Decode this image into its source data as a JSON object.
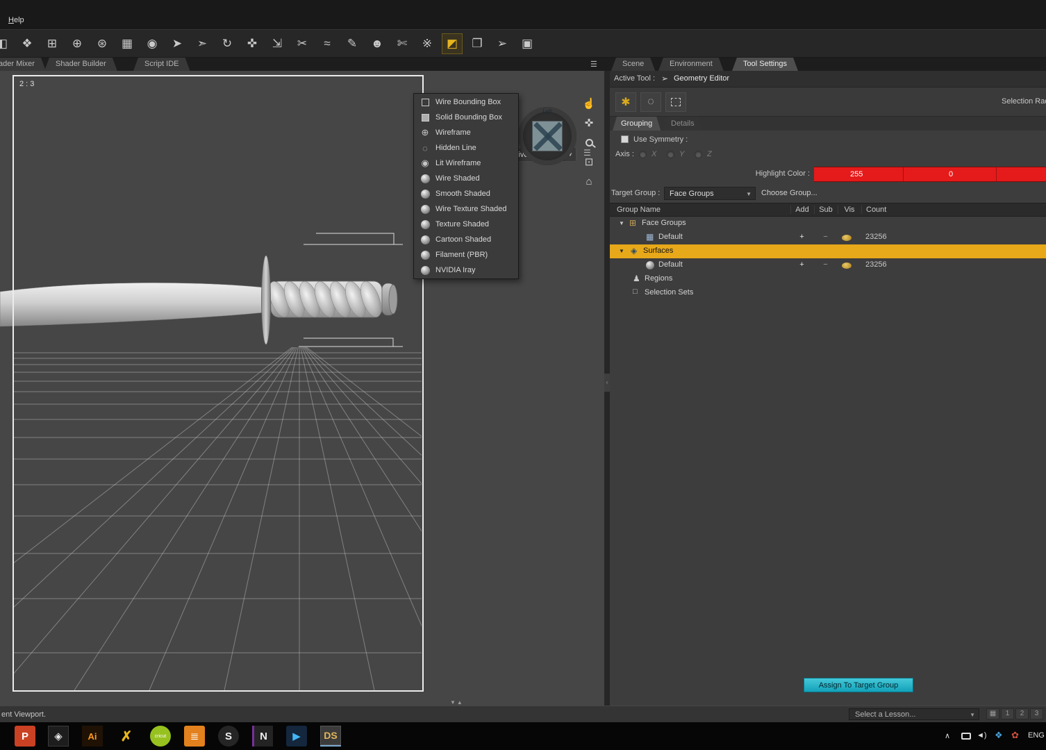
{
  "menubar": {
    "help": "Help"
  },
  "toolbar": {
    "icons": [
      {
        "name": "clipped-tool",
        "glyph": "◧"
      },
      {
        "name": "new-content",
        "glyph": "❖"
      },
      {
        "name": "add-figure",
        "glyph": "⊞"
      },
      {
        "name": "add-prop",
        "glyph": "⊕"
      },
      {
        "name": "add-light",
        "glyph": "⊛"
      },
      {
        "name": "grid-view",
        "glyph": "▦"
      },
      {
        "name": "scene-orb",
        "glyph": "◉"
      },
      {
        "name": "node-selection-tool",
        "glyph": "➤"
      },
      {
        "name": "geometry-selection-tool",
        "glyph": "➣"
      },
      {
        "name": "rotate-tool",
        "glyph": "↻"
      },
      {
        "name": "translate-tool",
        "glyph": "✜"
      },
      {
        "name": "scale-tool",
        "glyph": "⇲"
      },
      {
        "name": "scissors-tool",
        "glyph": "✂"
      },
      {
        "name": "curve-tool",
        "glyph": "≈"
      },
      {
        "name": "brush-tool",
        "glyph": "✎"
      },
      {
        "name": "figure-paint-tool",
        "glyph": "☻"
      },
      {
        "name": "polygon-cut-tool",
        "glyph": "✄"
      },
      {
        "name": "multi-cut-tool",
        "glyph": "※"
      },
      {
        "name": "geometry-editor-tool",
        "glyph": "◩"
      },
      {
        "name": "camera-cube-tool",
        "glyph": "❐"
      },
      {
        "name": "pointer-add-tool",
        "glyph": "➢"
      },
      {
        "name": "render-camera-tool",
        "glyph": "▣"
      }
    ]
  },
  "tabs": {
    "left": [
      "ader Mixer",
      "Shader Builder",
      "Script IDE"
    ],
    "right": [
      "Scene",
      "Environment",
      "Tool Settings"
    ]
  },
  "ui": {
    "arrow_down": "▼",
    "pane_icon": "☰",
    "tree_expanded": "▼"
  },
  "viewport": {
    "ratio_label": "2 : 3",
    "view_selector": "Perspective View",
    "orbit_label": "Left",
    "splitter_glyph": "▼▲",
    "nav_icons": [
      {
        "name": "orbit-icon",
        "glyph": "☝"
      },
      {
        "name": "pan-icon",
        "glyph": "✜"
      },
      {
        "name": "zoom-icon"
      },
      {
        "name": "frame-icon",
        "glyph": "⊡"
      },
      {
        "name": "home-icon",
        "glyph": "⌂"
      }
    ]
  },
  "draw_menu": {
    "items": [
      {
        "name": "wire-bounding-box",
        "label": "Wire Bounding Box"
      },
      {
        "name": "solid-bounding-box",
        "label": "Solid Bounding Box"
      },
      {
        "name": "wireframe",
        "label": "Wireframe",
        "glyph": "⊕"
      },
      {
        "name": "hidden-line",
        "label": "Hidden Line",
        "glyph": "◌"
      },
      {
        "name": "lit-wireframe",
        "label": "Lit Wireframe",
        "glyph": "◉"
      },
      {
        "name": "wire-shaded",
        "label": "Wire Shaded"
      },
      {
        "name": "smooth-shaded",
        "label": "Smooth Shaded"
      },
      {
        "name": "wire-texture-shaded",
        "label": "Wire Texture Shaded"
      },
      {
        "name": "texture-shaded",
        "label": "Texture Shaded"
      },
      {
        "name": "cartoon-shaded",
        "label": "Cartoon Shaded"
      },
      {
        "name": "filament-pbr",
        "label": "Filament (PBR)"
      },
      {
        "name": "nvidia-iray",
        "label": "NVIDIA Iray"
      }
    ]
  },
  "panel": {
    "active_tool_label": "Active Tool :",
    "active_tool_icon": "➢",
    "active_tool": "Geometry Editor",
    "selection_label": "Selection Rad",
    "subtabs": [
      "Grouping",
      "Details"
    ],
    "use_symmetry": "Use Symmetry :",
    "axis_label": "Axis :",
    "axis_options": [
      "X",
      "Y",
      "Z"
    ],
    "highlight_label": "Highlight Color :",
    "highlight_r": "255",
    "highlight_g": "0",
    "highlight_color": "#e51a1a",
    "target_label": "Target Group :",
    "target_value": "Face Groups",
    "choose_group": "Choose Group...",
    "headers": {
      "name": "Group Name",
      "add": "Add",
      "sub": "Sub",
      "vis": "Vis",
      "count": "Count"
    },
    "rows": {
      "face_groups": "Face Groups",
      "default1": "Default",
      "surfaces": "Surfaces",
      "default2": "Default",
      "regions": "Regions",
      "selection_sets": "Selection Sets",
      "plus": "+",
      "minus": "−",
      "count1": "23256",
      "count2": "23256"
    },
    "assign_button": "Assign To Target Group"
  },
  "statusbar": {
    "left": "ent Viewport.",
    "lesson": "Select a Lesson...",
    "layout_glyph": "▦",
    "pane_buttons": [
      "1",
      "2",
      "3"
    ]
  },
  "taskbar": {
    "apps": [
      {
        "name": "powerpoint",
        "label": "P"
      },
      {
        "name": "dark-app",
        "label": "◈"
      },
      {
        "name": "illustrator",
        "label": "Ai"
      },
      {
        "name": "cutter",
        "label": "✗"
      },
      {
        "name": "cricut",
        "label": "cricut"
      },
      {
        "name": "orange-app",
        "label": "≣"
      },
      {
        "name": "skype",
        "label": "S"
      },
      {
        "name": "onenote",
        "label": "N"
      },
      {
        "name": "media-player",
        "label": "▶"
      },
      {
        "name": "daz-studio",
        "label": "DS"
      }
    ],
    "tray": {
      "chevron": "∧",
      "speaker": "◄)",
      "net1": "❖",
      "net2": "✿",
      "lang": "ENG"
    }
  },
  "colors": {
    "accent_yellow": "#e7a81a",
    "highlight_red": "#e51a1a",
    "assign_cyan": "#18b4c8"
  }
}
